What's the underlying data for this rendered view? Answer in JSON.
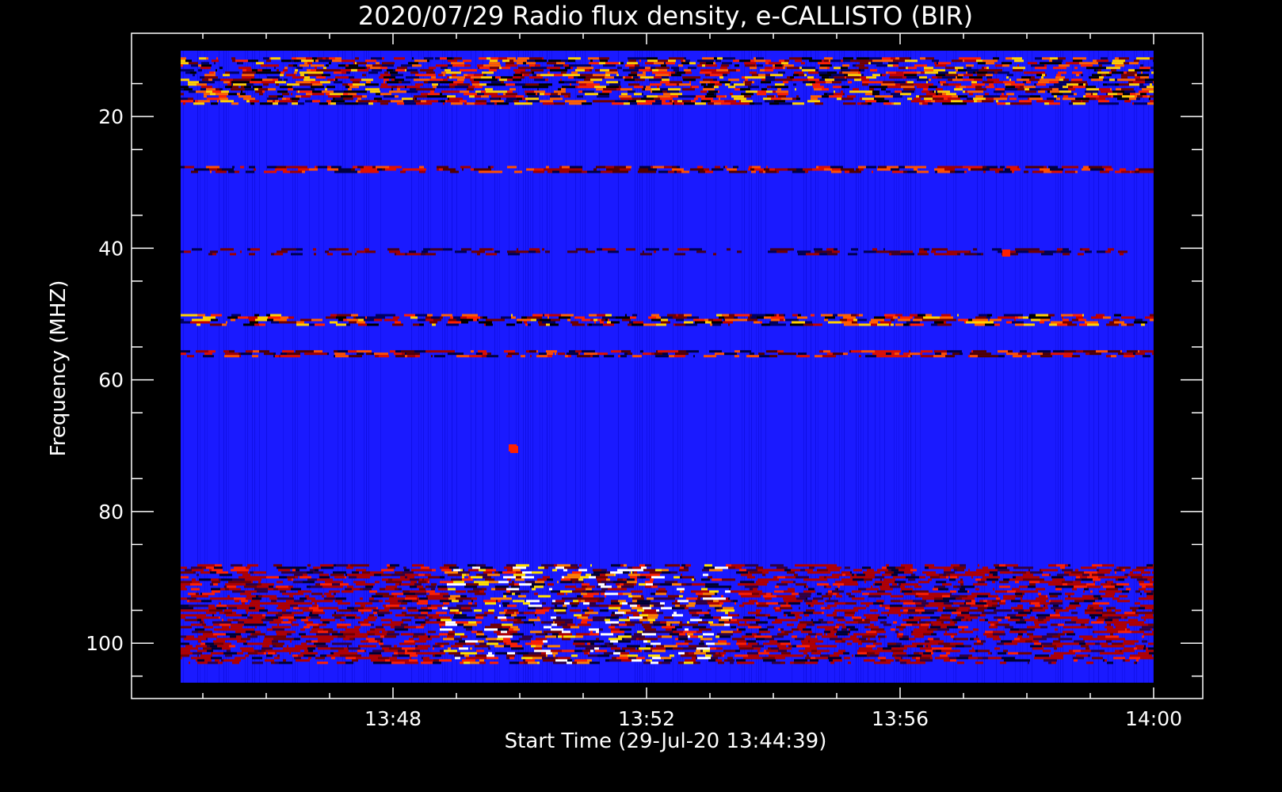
{
  "chart_data": {
    "type": "heatmap",
    "title": "2020/07/29  Radio flux density, e-CALLISTO (BIR)",
    "xlabel": "Start Time (29-Jul-20 13:44:39)",
    "ylabel": "Frequency (MHZ)",
    "x_ticks": [
      "13:48",
      "13:52",
      "13:56",
      "14:00"
    ],
    "x_tick_minutes": [
      228,
      232,
      236,
      240
    ],
    "x_range_minutes": [
      224.65,
      240
    ],
    "y_ticks": [
      "20",
      "40",
      "60",
      "80",
      "100"
    ],
    "y_tick_values": [
      20,
      40,
      60,
      80,
      100
    ],
    "y_range": [
      106,
      10
    ],
    "y_axis_inverted": true,
    "colormap": [
      "#000000",
      "#0000ff",
      "#ff0000",
      "#ffff00",
      "#ffffff"
    ],
    "background_color": "#1a1aff",
    "interference_bands": [
      {
        "mhz": [
          11,
          18
        ],
        "level": "strong"
      },
      {
        "mhz": [
          27.5,
          28.5
        ],
        "level": "medium"
      },
      {
        "mhz": [
          40,
          41
        ],
        "level": "weak"
      },
      {
        "mhz": [
          50,
          51.5
        ],
        "level": "strong"
      },
      {
        "mhz": [
          55.5,
          56.5
        ],
        "level": "medium"
      },
      {
        "mhz": [
          88,
          103
        ],
        "level": "burst"
      }
    ]
  }
}
